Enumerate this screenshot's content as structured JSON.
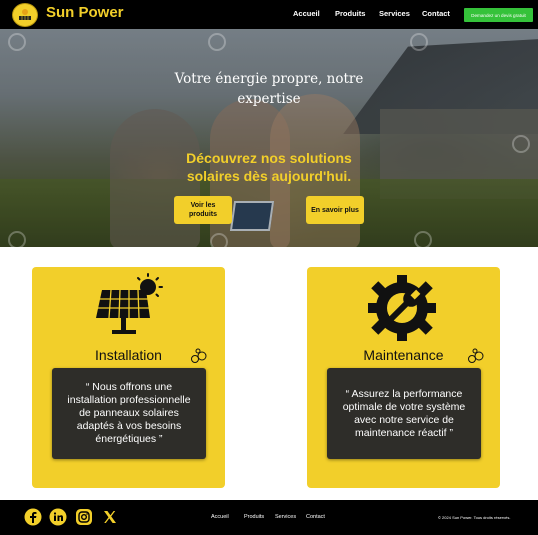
{
  "brand": {
    "name": "Sun Power"
  },
  "nav": {
    "items": [
      "Accueil",
      "Produits",
      "Services",
      "Contact"
    ],
    "cta_label": "Demandez un devis gratuit"
  },
  "hero": {
    "tagline": "Votre énergie propre, notre expertise",
    "headline": "Découvrez nos solutions solaires dès aujourd'hui.",
    "btn_products": "Voir les produits",
    "btn_more": "En savoir plus"
  },
  "cards": [
    {
      "title": "Installation",
      "icon": "solar-panel-icon",
      "text": "“ Nous offrons une installation professionnelle de panneaux solaires adaptés à vos besoins énergétiques ”"
    },
    {
      "title": "Maintenance",
      "icon": "gear-wrench-icon",
      "text": "“ Assurez la performance optimale de votre système avec notre service de maintenance réactif ”"
    }
  ],
  "footer": {
    "social": [
      "facebook-icon",
      "linkedin-icon",
      "instagram-icon",
      "x-icon"
    ],
    "nav": [
      "Accueil",
      "Produits",
      "Services",
      "Contact"
    ],
    "copyright": "© 2024 Sun Power. Tous droits réservés."
  },
  "colors": {
    "accent": "#f2cf2a",
    "cta": "#35c23a",
    "dark": "#000000",
    "box": "#2e2d29"
  }
}
